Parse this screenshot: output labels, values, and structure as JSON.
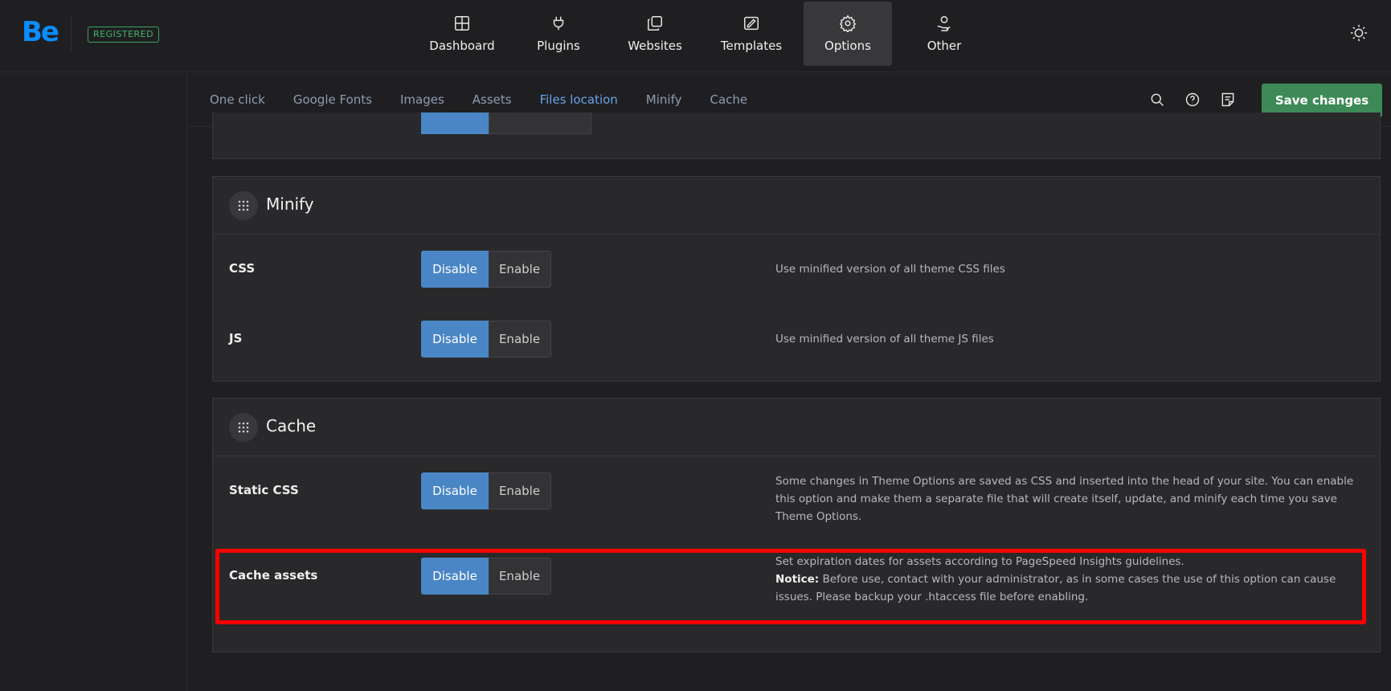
{
  "brand": {
    "logo": "Be",
    "badge": "REGISTERED"
  },
  "nav": [
    {
      "label": "Dashboard",
      "icon": "dashboard-icon"
    },
    {
      "label": "Plugins",
      "icon": "plug-icon"
    },
    {
      "label": "Websites",
      "icon": "websites-icon"
    },
    {
      "label": "Templates",
      "icon": "templates-icon"
    },
    {
      "label": "Options",
      "icon": "gear-icon",
      "active": true
    },
    {
      "label": "Other",
      "icon": "hand-user-icon"
    }
  ],
  "subtabs": [
    {
      "label": "One click"
    },
    {
      "label": "Google Fonts"
    },
    {
      "label": "Images"
    },
    {
      "label": "Assets"
    },
    {
      "label": "Files location",
      "active": true
    },
    {
      "label": "Minify"
    },
    {
      "label": "Cache"
    }
  ],
  "toolbar": {
    "save_label": "Save changes"
  },
  "colors": {
    "accent": "#4a86c5",
    "save": "#3d8a56",
    "registered": "#43b56a",
    "highlight": "#ff0000"
  },
  "minify": {
    "title": "Minify",
    "rows": [
      {
        "label": "CSS",
        "disable": "Disable",
        "enable": "Enable",
        "desc": "Use minified version of all theme CSS files"
      },
      {
        "label": "JS",
        "disable": "Disable",
        "enable": "Enable",
        "desc": "Use minified version of all theme JS files"
      }
    ]
  },
  "cache": {
    "title": "Cache",
    "rows": [
      {
        "label": "Static CSS",
        "disable": "Disable",
        "enable": "Enable",
        "desc": "Some changes in Theme Options are saved as CSS and inserted into the head of your site. You can enable this option and make them a separate file that will create itself, update, and minify each time you save Theme Options."
      },
      {
        "label": "Cache assets",
        "disable": "Disable",
        "enable": "Enable",
        "desc": "Set expiration dates for assets according to PageSpeed Insights guidelines.",
        "notice_label": "Notice:",
        "notice": " Before use, contact with your administrator, as in some cases the use of this option can cause issues. Please backup your .htaccess file before enabling."
      }
    ]
  }
}
